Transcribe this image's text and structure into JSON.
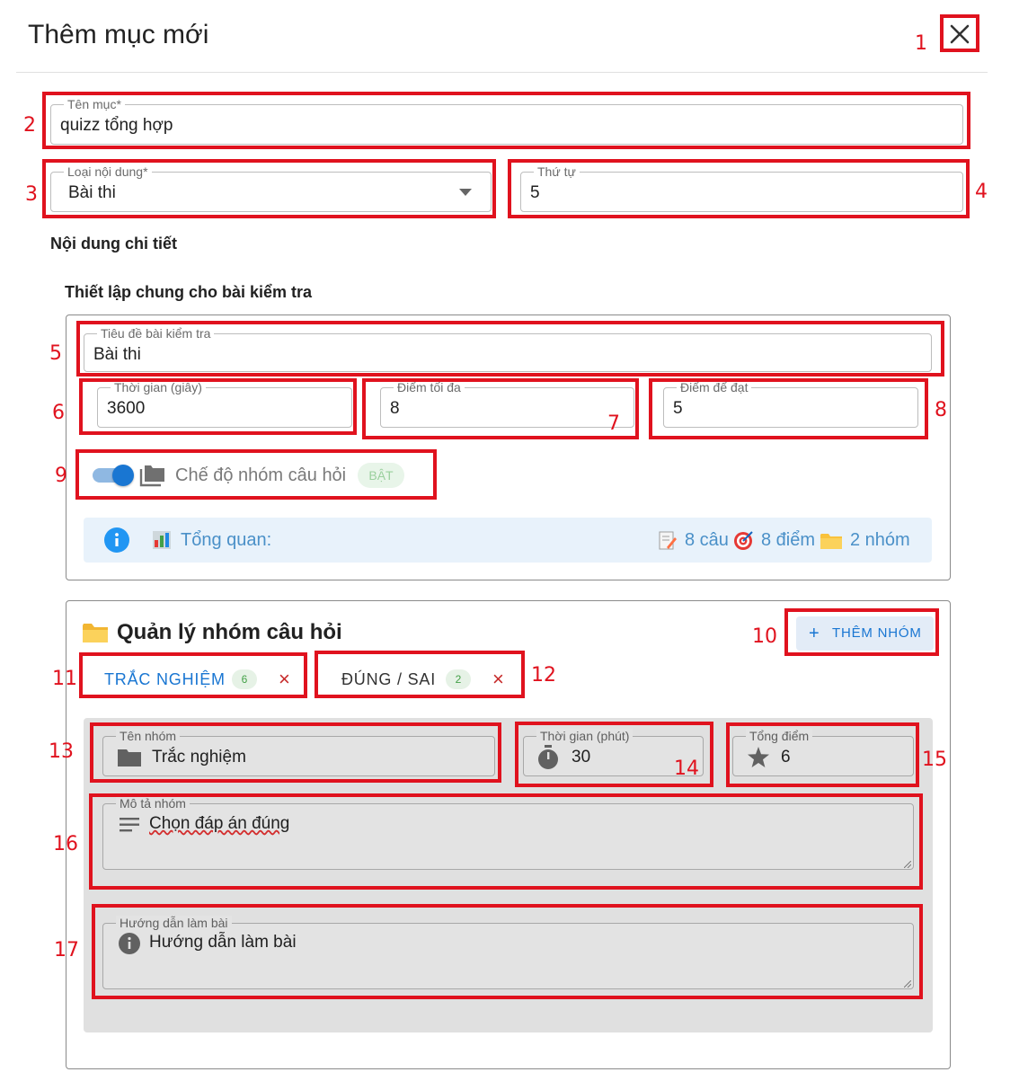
{
  "dialog": {
    "title": "Thêm mục mới"
  },
  "fields": {
    "ten_muc": {
      "label": "Tên mục*",
      "value": "quizz tổng hợp"
    },
    "loai_noi_dung": {
      "label": "Loại nội dung*",
      "value": "Bài thi"
    },
    "thu_tu": {
      "label": "Thứ tự",
      "value": "5"
    }
  },
  "content": {
    "detail_title": "Nội dung chi tiết",
    "settings_title": "Thiết lập chung cho bài kiểm tra"
  },
  "exam": {
    "title_label": "Tiêu đề bài kiểm tra",
    "title_value": "Bài thi",
    "time_label": "Thời gian (giây)",
    "time_value": "3600",
    "max_label": "Điểm tối đa",
    "max_value": "8",
    "pass_label": "Điểm để đạt",
    "pass_value": "5",
    "group_mode_label": "Chế độ nhóm câu hỏi",
    "group_mode_badge": "BẬT",
    "overview_label": "Tổng quan:",
    "overview_questions": "8 câu",
    "overview_points": "8 điểm",
    "overview_groups": "2 nhóm"
  },
  "groups": {
    "title": "Quản lý nhóm câu hỏi",
    "add_button": "THÊM NHÓM",
    "tabs": [
      {
        "label": "TRẮC NGHIỆM",
        "count": "6"
      },
      {
        "label": "ĐÚNG / SAI",
        "count": "2"
      }
    ],
    "group_name_label": "Tên nhóm",
    "group_name_value": "Trắc nghiệm",
    "group_time_label": "Thời gian (phút)",
    "group_time_value": "30",
    "group_points_label": "Tổng điểm",
    "group_points_value": "6",
    "group_desc_label": "Mô tả nhóm",
    "group_desc_value": "Chọn đáp án đúng",
    "guide_label": "Hướng dẫn làm bài",
    "guide_placeholder": "Hướng dẫn làm bài"
  },
  "annotations": [
    "1",
    "2",
    "3",
    "4",
    "5",
    "6",
    "7",
    "8",
    "9",
    "10",
    "11",
    "12",
    "13",
    "14",
    "15",
    "16",
    "17"
  ],
  "colors": {
    "annotation_red": "#e0121e",
    "primary_blue": "#1976d2",
    "info_bg": "#e8f2fb",
    "gray_panel": "#e0e0e0",
    "tab_delete": "#c62828"
  }
}
